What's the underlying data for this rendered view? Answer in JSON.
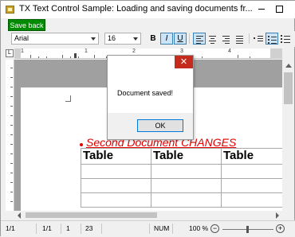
{
  "window": {
    "title": "TX Text Control Sample: Loading and saving documents fr..."
  },
  "toolbar": {
    "save_back_label": "Save back",
    "font_name": "Arial",
    "font_size": "16"
  },
  "format": {
    "bold_label": "B",
    "italic_label": "I",
    "underline_label": "U",
    "italic_active": true,
    "underline_active": true,
    "align_left_active": true
  },
  "ruler": {
    "corner_label": "L",
    "labels": [
      "1",
      "1",
      "2",
      "3",
      "4",
      "5"
    ]
  },
  "document": {
    "bullet_text": "Second Document CHANGES",
    "table_rows": [
      [
        "Table",
        "Table",
        "Table"
      ],
      [
        "",
        "",
        ""
      ],
      [
        "",
        "",
        ""
      ],
      [
        "",
        "",
        ""
      ]
    ]
  },
  "dialog": {
    "message": "Document saved!",
    "ok_label": "OK",
    "close_glyph": "✕"
  },
  "statusbar": {
    "page": "1/1",
    "section": "1/1",
    "line": "1",
    "column": "23",
    "mode": "NUM",
    "zoom": "100 %",
    "zoom_out_glyph": "−",
    "zoom_in_glyph": "+"
  },
  "colors": {
    "save_button_bg": "#008a00",
    "document_text": "#e00000",
    "dialog_close_bg": "#c42b1c"
  }
}
